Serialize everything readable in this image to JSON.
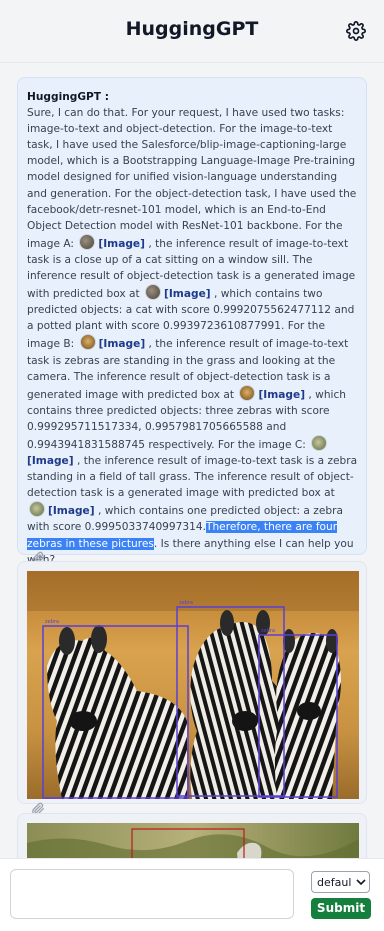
{
  "header": {
    "title": "HuggingGPT"
  },
  "message": {
    "sender": "HuggingGPT :",
    "t1": "Sure, I can do that. For your request, I have used two tasks: image-to-text and object-detection. For the image-to-text task, I have used the Salesforce/blip-image-captioning-large model, which is a Bootstrapping Language-Image Pre-training model designed for unified vision-language understanding and generation. For the object-detection task, I have used the facebook/detr-resnet-101 model, which is an End-to-End Object Detection model with ResNet-101 backbone. For the image A:",
    "t2": ", the inference result of image-to-text task is a close up of a cat sitting on a window sill. The inference result of object-detection task is a generated image with predicted box at",
    "t3": ", which contains two predicted objects: a cat with score 0.9992075562477112 and a potted plant with score 0.9939723610877991. For the image B:",
    "t4": ", the inference result of image-to-text task is zebras are standing in the grass and looking at the camera. The inference result of object-detection task is a generated image with predicted box at",
    "t5": ", which contains three predicted objects: three zebras with score 0.999295711517334, 0.9957981705665588 and 0.9943941831588745 respectively. For the image C:",
    "t6": ", the inference result of image-to-text task is a zebra standing in a field of tall grass. The inference result of object-detection task is a generated image with predicted box at",
    "t7": ", which contains one predicted object: a zebra with score 0.9995033740997314.",
    "highlight": "Therefore, there are four zebras in these pictures",
    "t8": ". Is there anything else I can help you with?",
    "image_link": "[Image]"
  },
  "image1": {
    "labels": [
      "zebra",
      "zebra",
      "zebra"
    ]
  },
  "footer": {
    "model_select": "defaul",
    "submit_label": "Submit",
    "input_value": ""
  },
  "colors": {
    "highlight": "#3b82f6",
    "submit": "#15803d",
    "link": "#1e3a8a",
    "box": "#5b3fd6"
  },
  "icons": {
    "settings": "gear-icon",
    "attachment": "paperclip-icon",
    "dropdown": "chevron-down-icon"
  }
}
